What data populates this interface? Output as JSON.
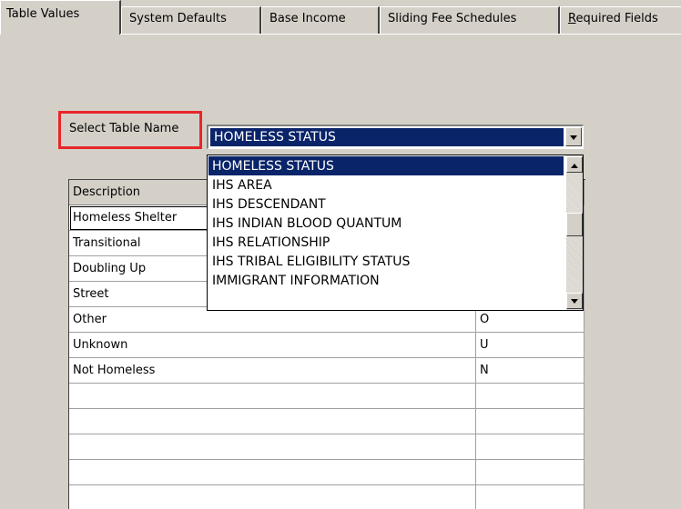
{
  "tabs": [
    {
      "label": "Table Values",
      "active": true
    },
    {
      "label": "System Defaults",
      "active": false
    },
    {
      "label": "Base Income",
      "active": false
    },
    {
      "label": "Sliding Fee Schedules",
      "active": false
    },
    {
      "label": "Required Fields",
      "active": false,
      "mnemonic": "R"
    }
  ],
  "select_table": {
    "label": "Select Table Name",
    "value": "HOMELESS STATUS",
    "options": [
      "HOMELESS STATUS",
      "IHS AREA",
      "IHS DESCENDANT",
      "IHS INDIAN BLOOD QUANTUM",
      "IHS RELATIONSHIP",
      "IHS TRIBAL ELIGIBILITY STATUS",
      "IMMIGRANT INFORMATION"
    ],
    "selected_option": "HOMELESS STATUS"
  },
  "grid": {
    "columns": [
      "Description",
      ""
    ],
    "rows": [
      [
        "Homeless Shelter",
        ""
      ],
      [
        "Transitional",
        ""
      ],
      [
        "Doubling Up",
        ""
      ],
      [
        "Street",
        ""
      ],
      [
        "Other",
        "O"
      ],
      [
        "Unknown",
        "U"
      ],
      [
        "Not Homeless",
        "N"
      ],
      [
        "",
        ""
      ],
      [
        "",
        ""
      ],
      [
        "",
        ""
      ],
      [
        "",
        ""
      ],
      [
        "",
        ""
      ]
    ]
  },
  "colors": {
    "highlight_border": "#e8262a",
    "selection": "#0a246a",
    "window_bg": "#d4d0c8"
  }
}
